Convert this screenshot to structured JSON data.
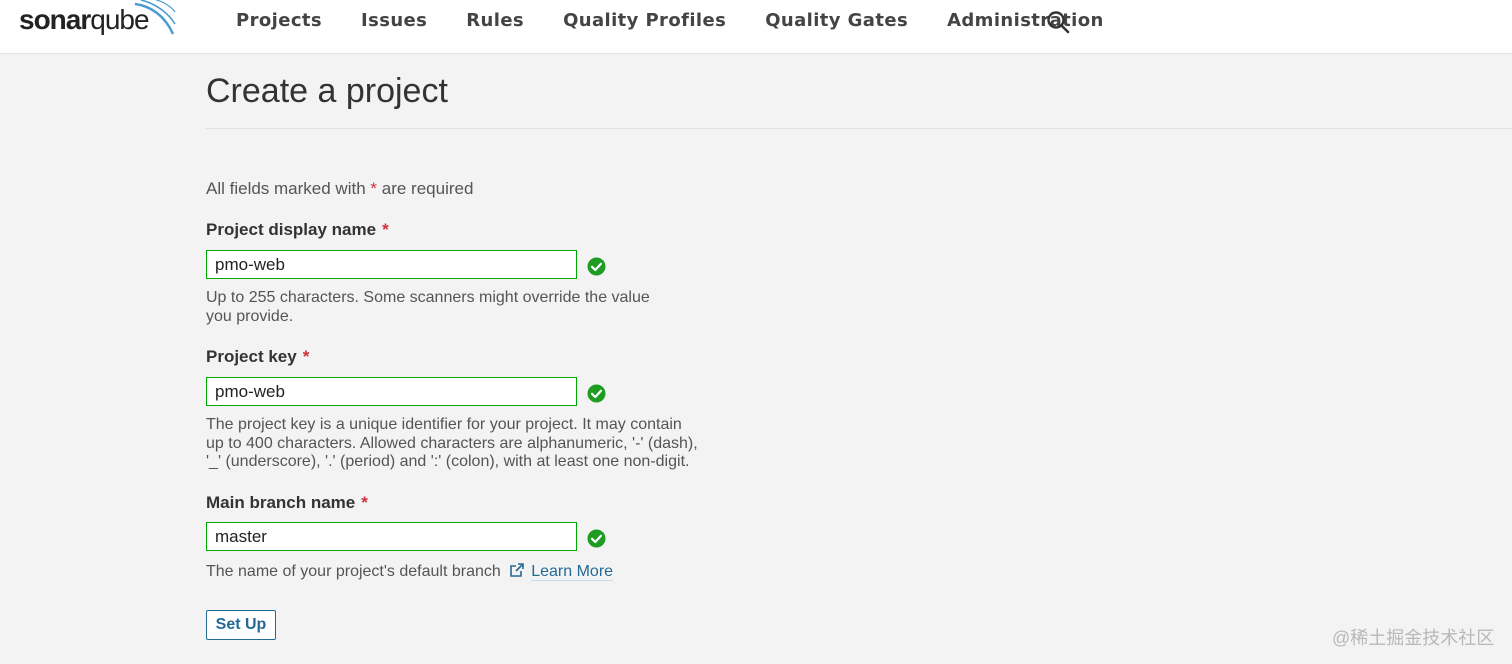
{
  "brand": {
    "logo_text_bold": "sonar",
    "logo_text_light": "qube"
  },
  "nav": {
    "items": [
      {
        "label": "Projects"
      },
      {
        "label": "Issues"
      },
      {
        "label": "Rules"
      },
      {
        "label": "Quality Profiles"
      },
      {
        "label": "Quality Gates"
      },
      {
        "label": "Administration"
      }
    ],
    "search_icon": "search-icon"
  },
  "page": {
    "title": "Create a project",
    "required_note_prefix": "All fields marked with",
    "required_star": "*",
    "required_note_suffix": "are required"
  },
  "form": {
    "display_name": {
      "label": "Project display name",
      "required": "*",
      "value": "pmo-web",
      "help": "Up to 255 characters. Some scanners might override the value you provide."
    },
    "project_key": {
      "label": "Project key",
      "required": "*",
      "value": "pmo-web",
      "help": "The project key is a unique identifier for your project. It may contain up to 400 characters. Allowed characters are alphanumeric, '-' (dash), '_' (underscore), '.' (period) and ':' (colon), with at least one non-digit."
    },
    "main_branch": {
      "label": "Main branch name",
      "required": "*",
      "value": "master",
      "help": "The name of your project's default branch",
      "learn_more": "Learn More"
    },
    "submit_label": "Set Up"
  },
  "watermark": "@稀土掘金技术社区",
  "colors": {
    "valid": "#00aa00",
    "required": "#d02f3a",
    "link": "#236a97",
    "background": "#f3f3f3"
  }
}
